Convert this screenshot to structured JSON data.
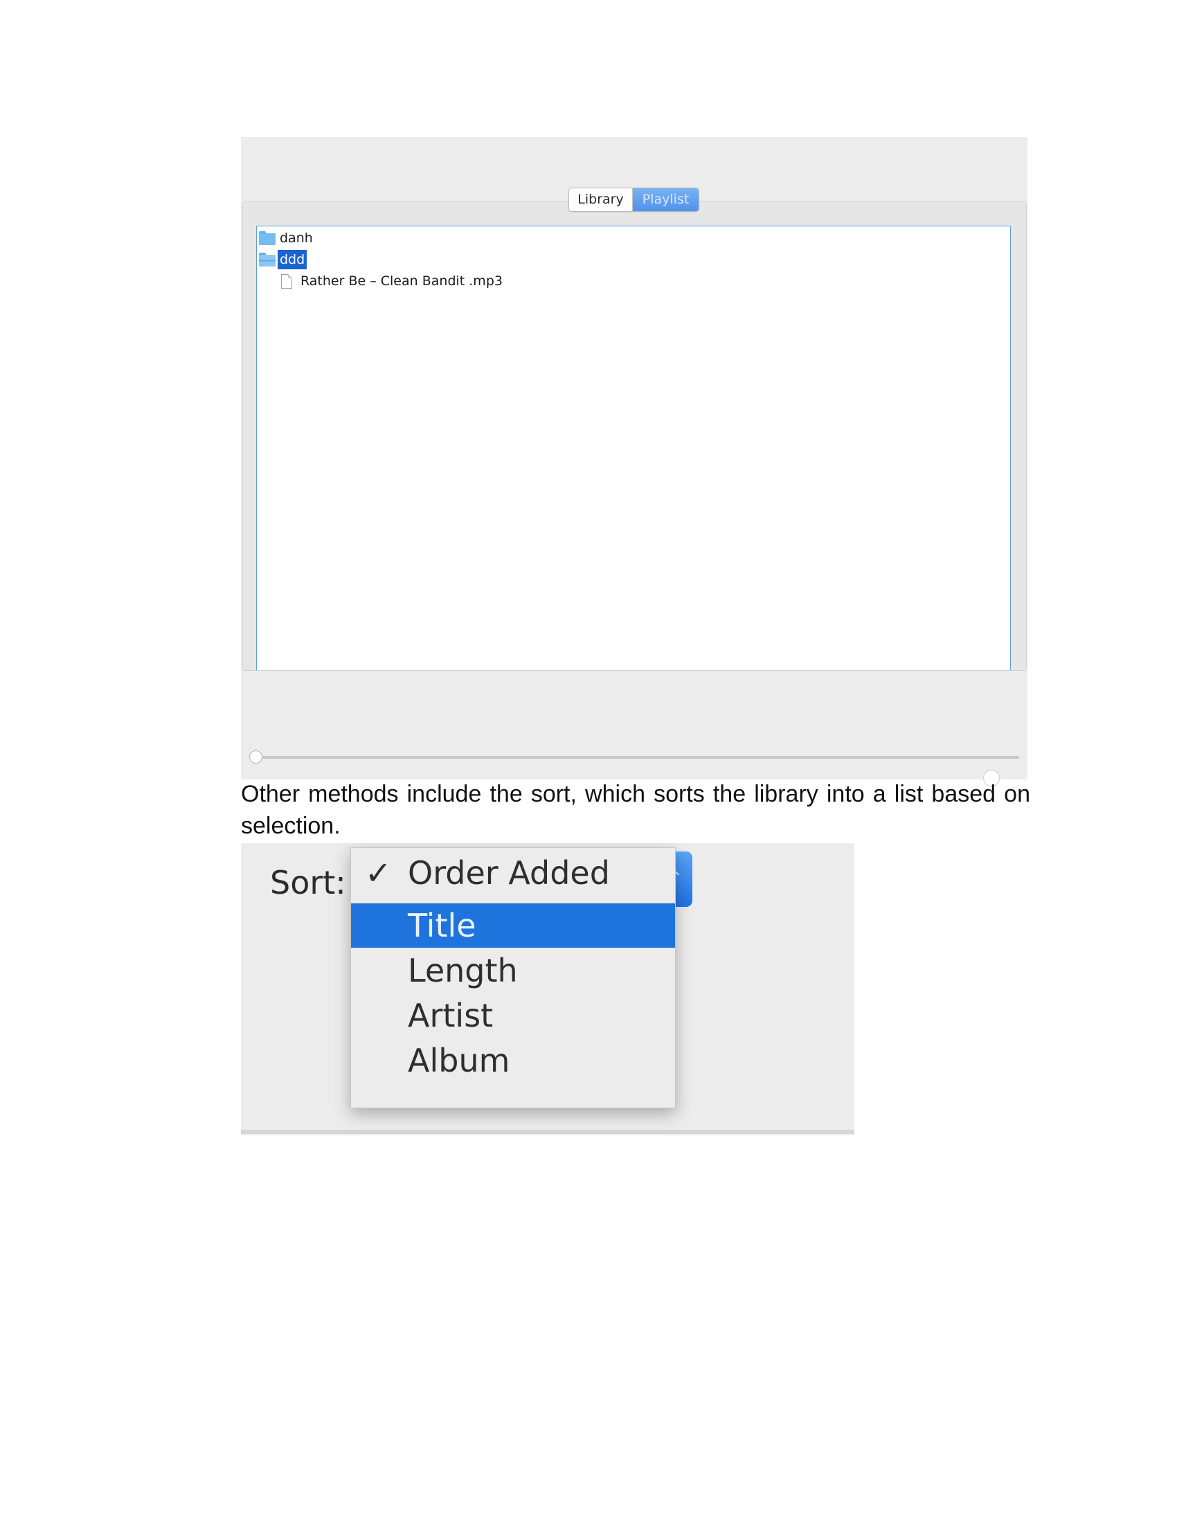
{
  "playlist_panel": {
    "tabs": [
      {
        "label": "Library",
        "selected": false
      },
      {
        "label": "Playlist",
        "selected": true
      }
    ],
    "tree": [
      {
        "label": "danh",
        "type": "folder",
        "icon": "folder-icon",
        "expanded": false,
        "selected": false
      },
      {
        "label": "ddd",
        "type": "folder",
        "icon": "folder-open-icon",
        "expanded": true,
        "selected": true
      },
      {
        "label": "Rather Be – Clean Bandit .mp3",
        "type": "file",
        "icon": "file-icon",
        "selected": false
      }
    ]
  },
  "paragraph": "Other methods include the sort, which sorts the library into a list based on selection.",
  "sort_panel": {
    "label": "Sort:",
    "menu": [
      {
        "label": "Order Added",
        "checked": true,
        "highlighted": false,
        "check_glyph": "✓"
      },
      {
        "label": "Title",
        "checked": false,
        "highlighted": true,
        "check_glyph": ""
      },
      {
        "label": "Length",
        "checked": false,
        "highlighted": false,
        "check_glyph": ""
      },
      {
        "label": "Artist",
        "checked": false,
        "highlighted": false,
        "check_glyph": ""
      },
      {
        "label": "Album",
        "checked": false,
        "highlighted": false,
        "check_glyph": ""
      }
    ],
    "popup_arrows_glyph": "⌃",
    "accent_color": "#1e73dc"
  }
}
